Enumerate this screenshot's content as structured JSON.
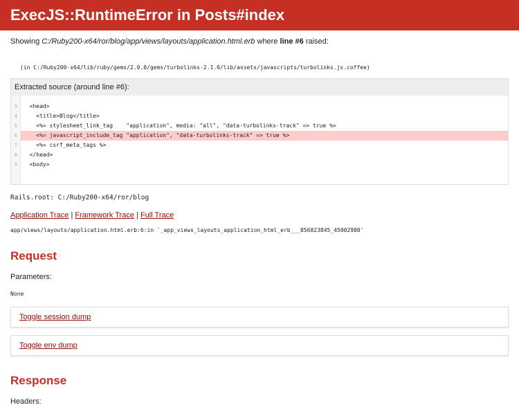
{
  "header": {
    "title": "ExecJS::RuntimeError in Posts#index"
  },
  "showing": {
    "prefix": "Showing ",
    "path": "C:/Ruby200-x64/ror/blog/app/views/layouts/application.html.erb",
    "middle": " where ",
    "line": "line #6",
    "suffix": " raised:"
  },
  "error_message": "(in C:/Ruby200-x64/lib/ruby/gems/2.0.0/gems/turbolinks-2.1.0/lib/assets/javascripts/turbolinks.js.coffee)",
  "source": {
    "title": "Extracted source (around line #6):",
    "lines": [
      {
        "number": "3",
        "code": "  <head>"
      },
      {
        "number": "4",
        "code": "    <title>Blog</title>"
      },
      {
        "number": "5",
        "code": "    <%= stylesheet_link_tag    \"application\", media: \"all\", \"data-turbolinks-track\" => true %>"
      },
      {
        "number": "6",
        "code": "    <%= javascript_include_tag \"application\", \"data-turbolinks-track\" => true %>"
      },
      {
        "number": "7",
        "code": "    <%= csrf_meta_tags %>"
      },
      {
        "number": "8",
        "code": "  </head>"
      },
      {
        "number": "9",
        "code": "  <body>"
      }
    ],
    "highlight_index": 3
  },
  "rails_root": "Rails.root: C:/Ruby200-x64/ror/blog",
  "trace_links": {
    "application": "Application Trace",
    "separator": " | ",
    "framework": "Framework Trace",
    "full": "Full Trace"
  },
  "trace_file": "app/views/layouts/application.html.erb:6:in `_app_views_layouts_application_html_erb___856823845_45002980'",
  "request": {
    "title": "Request",
    "parameters_label": "Parameters:",
    "parameters_value": "None",
    "toggle_session": "Toggle session dump",
    "toggle_env": "Toggle env dump"
  },
  "response": {
    "title": "Response",
    "headers_label": "Headers:"
  },
  "colors": {
    "header_bg": "#c52f24",
    "link": "#980905",
    "highlight": "#ffcccc"
  }
}
